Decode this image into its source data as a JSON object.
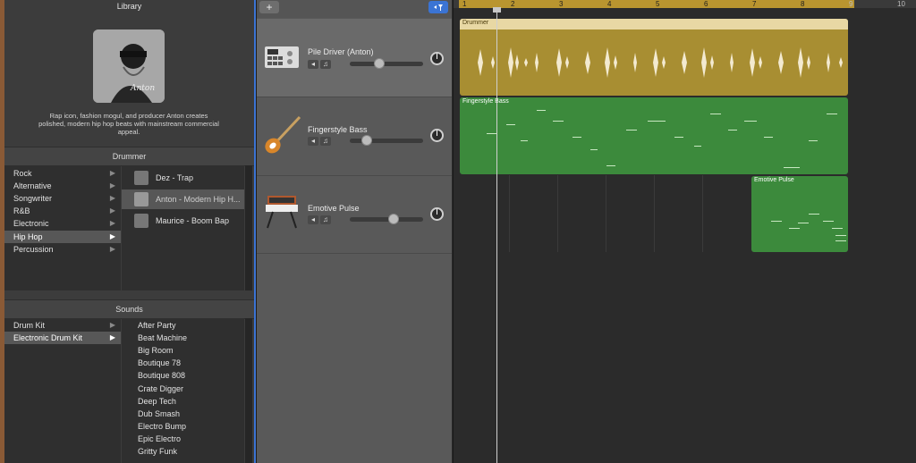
{
  "library": {
    "title": "Library",
    "description": "Rap icon, fashion mogul, and producer Anton creates polished, modern hip hop beats with mainstream commercial appeal.",
    "drummer_header": "Drummer",
    "genres": [
      "Rock",
      "Alternative",
      "Songwriter",
      "R&B",
      "Electronic",
      "Hip Hop",
      "Percussion"
    ],
    "selected_genre": "Hip Hop",
    "drummers": [
      "Dez - Trap",
      "Anton - Modern Hip H...",
      "Maurice - Boom Bap"
    ],
    "selected_drummer": "Anton - Modern Hip H...",
    "sounds_header": "Sounds",
    "kit_types": [
      "Drum Kit",
      "Electronic Drum Kit"
    ],
    "selected_kit_type": "Electronic Drum Kit",
    "sounds": [
      "After Party",
      "Beat Machine",
      "Big Room",
      "Boutique 78",
      "Boutique 808",
      "Crate Digger",
      "Deep Tech",
      "Dub Smash",
      "Electro Bump",
      "Epic Electro",
      "Gritty Funk"
    ]
  },
  "toolbar": {
    "add_track": "+",
    "filter_icon": "smart-controls-filter-icon"
  },
  "tracks": [
    {
      "name": "Pile Driver (Anton)",
      "icon": "drum-machine-icon",
      "volume": 0.4
    },
    {
      "name": "Fingerstyle Bass",
      "icon": "bass-guitar-icon",
      "volume": 0.24
    },
    {
      "name": "Emotive Pulse",
      "icon": "synthesizer-icon",
      "volume": 0.6
    }
  ],
  "ruler": {
    "bars": [
      "1",
      "2",
      "3",
      "4",
      "5",
      "6",
      "7",
      "8",
      "9",
      "10"
    ]
  },
  "regions": [
    {
      "label": "Drummer",
      "color": "#a88e32"
    },
    {
      "label": "Fingerstyle Bass",
      "color": "#3c8a3c"
    },
    {
      "label": "Emotive Pulse",
      "color": "#3c8a3c"
    }
  ],
  "colors": {
    "accent": "#3b74d4",
    "drummer": "#a88e32",
    "midi": "#3c8a3c"
  }
}
